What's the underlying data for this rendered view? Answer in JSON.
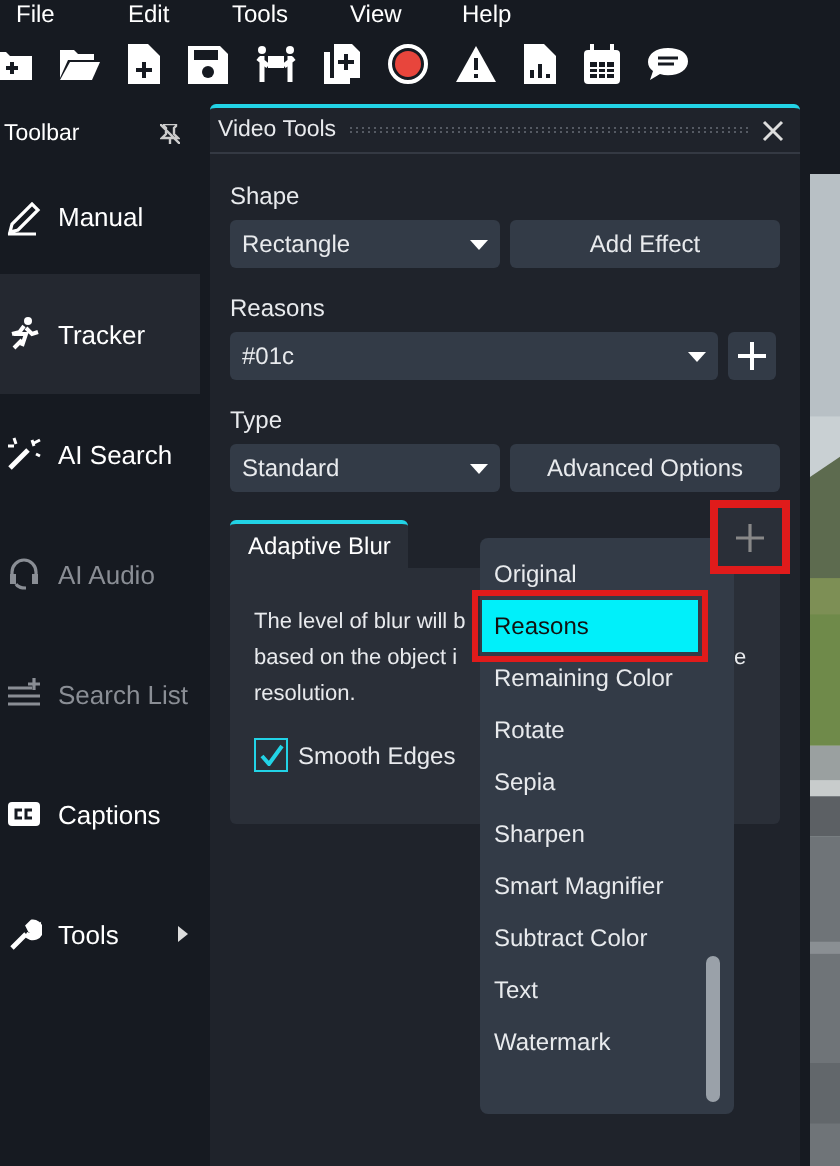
{
  "menu": [
    "File",
    "Edit",
    "Tools",
    "View",
    "Help"
  ],
  "sidebar": {
    "title": "Toolbar",
    "items": [
      {
        "label": "Manual",
        "selected": false,
        "disabled": false,
        "submenu": false
      },
      {
        "label": "Tracker",
        "selected": true,
        "disabled": false,
        "submenu": false
      },
      {
        "label": "AI Search",
        "selected": false,
        "disabled": false,
        "submenu": false
      },
      {
        "label": "AI Audio",
        "selected": false,
        "disabled": true,
        "submenu": false
      },
      {
        "label": "Search List",
        "selected": false,
        "disabled": true,
        "submenu": false
      },
      {
        "label": "Captions",
        "selected": false,
        "disabled": false,
        "submenu": false
      },
      {
        "label": "Tools",
        "selected": false,
        "disabled": false,
        "submenu": true
      }
    ]
  },
  "panel": {
    "title": "Video Tools",
    "rows": [
      {
        "label": "Shape",
        "select": "Rectangle",
        "kind": "button",
        "button": "Add Effect"
      },
      {
        "label": "Reasons",
        "select": "#01c",
        "kind": "add"
      },
      {
        "label": "Type",
        "select": "Standard",
        "kind": "button",
        "button": "Advanced Options"
      }
    ],
    "effect": {
      "tab": "Adaptive Blur",
      "selected": true,
      "add_highlighted": true,
      "description": [
        [
          "The level of blur will b"
        ],
        [
          "based on the object i",
          "e"
        ],
        [
          "resolution."
        ]
      ],
      "checkbox": {
        "label": "Smooth Edges",
        "checked": true
      }
    },
    "dropdown": {
      "items": [
        {
          "label": "Original",
          "selected": false,
          "highlighted": false
        },
        {
          "label": "Reasons",
          "selected": true,
          "highlighted": true
        },
        {
          "label": "Remaining Color",
          "selected": false,
          "highlighted": false
        },
        {
          "label": "Rotate",
          "selected": false,
          "highlighted": false
        },
        {
          "label": "Sepia",
          "selected": false,
          "highlighted": false
        },
        {
          "label": "Sharpen",
          "selected": false,
          "highlighted": false
        },
        {
          "label": "Smart Magnifier",
          "selected": false,
          "highlighted": false
        },
        {
          "label": "Subtract Color",
          "selected": false,
          "highlighted": false
        },
        {
          "label": "Text",
          "selected": false,
          "highlighted": false
        },
        {
          "label": "Watermark",
          "selected": false,
          "highlighted": false
        }
      ]
    }
  }
}
